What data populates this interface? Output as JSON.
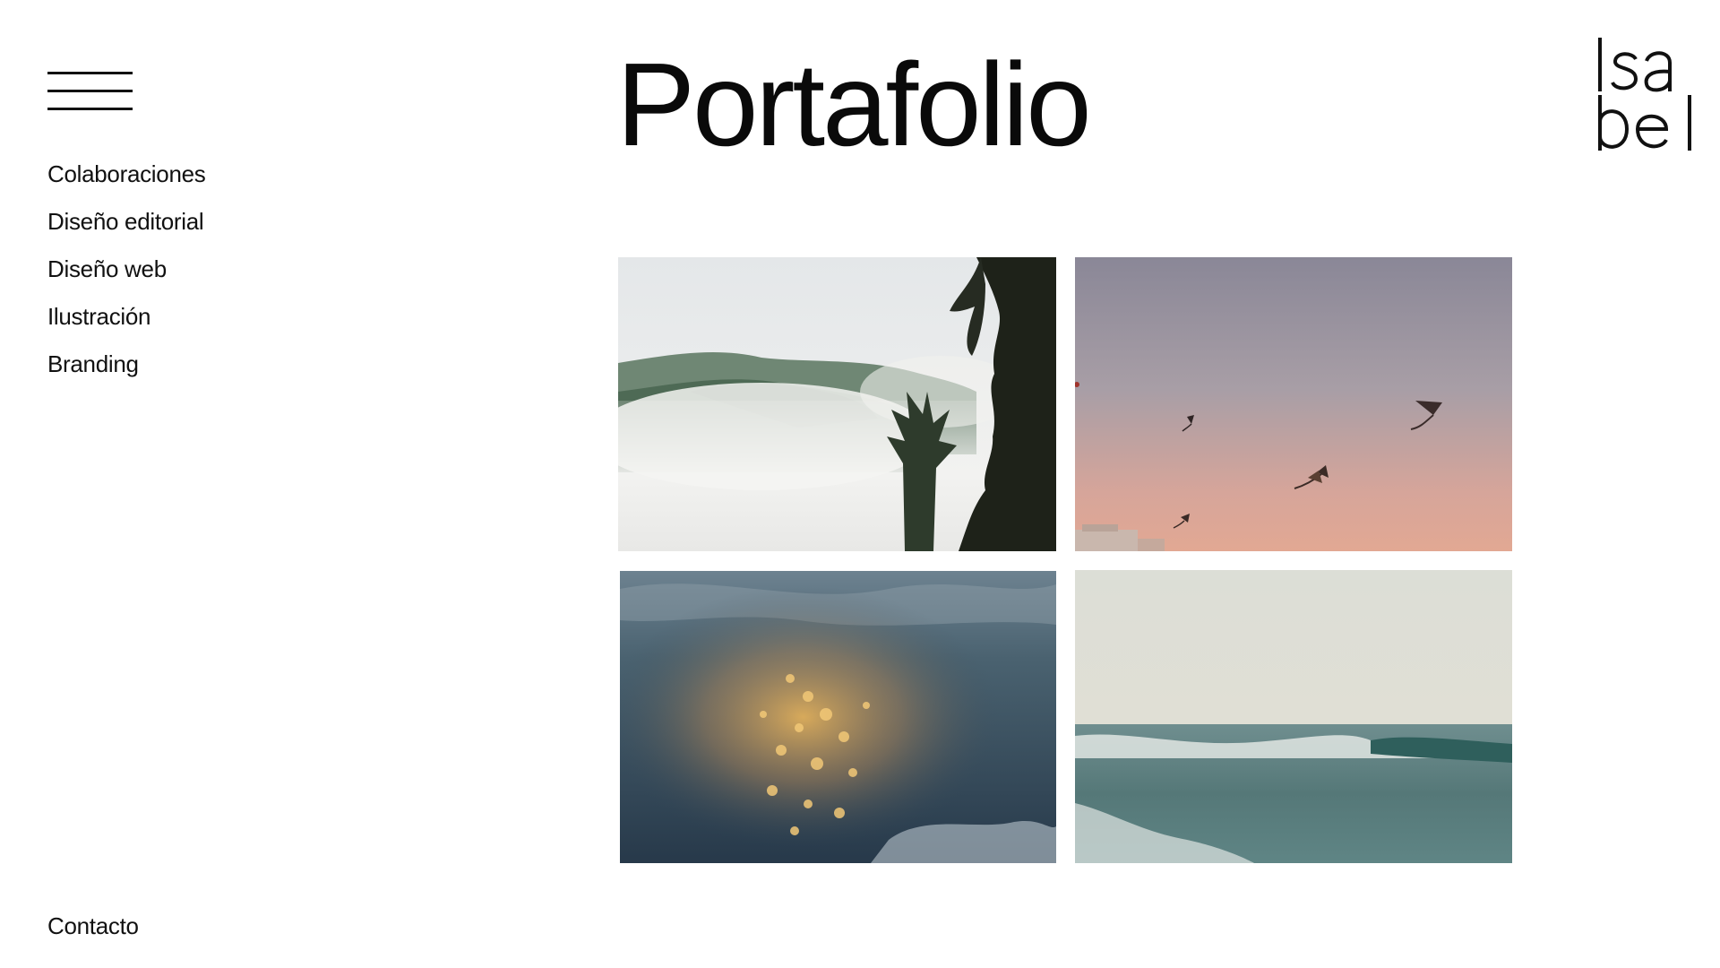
{
  "page": {
    "title": "Portafolio"
  },
  "logo": {
    "alt": "Isabel",
    "line1": "Isa",
    "line2": "bel"
  },
  "menu": {
    "icon": "hamburger-menu-icon"
  },
  "sidebar": {
    "items": [
      {
        "label": "Colaboraciones"
      },
      {
        "label": "Diseño editorial"
      },
      {
        "label": "Diseño web"
      },
      {
        "label": "Ilustración"
      },
      {
        "label": "Branding"
      }
    ],
    "contact_label": "Contacto"
  },
  "gallery": {
    "photos": [
      {
        "subject": "misty-forest-mountain"
      },
      {
        "subject": "kites-in-dusk-sky"
      },
      {
        "subject": "sunlit-water-close-up"
      },
      {
        "subject": "ocean-wave-shore"
      }
    ]
  },
  "colors": {
    "text": "#111111",
    "background": "#ffffff"
  }
}
